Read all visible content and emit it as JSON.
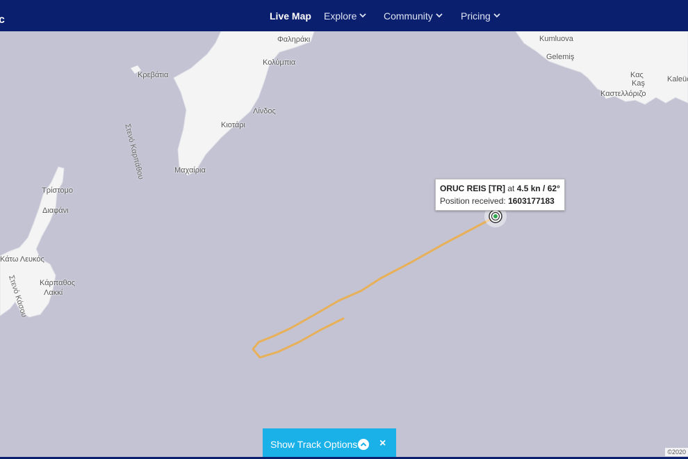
{
  "brand": {
    "text": "c"
  },
  "nav": [
    {
      "label": "Live Map",
      "active": true
    },
    {
      "label": "Explore",
      "dropdown": true
    },
    {
      "label": "Community",
      "dropdown": true
    },
    {
      "label": "Pricing",
      "dropdown": true
    }
  ],
  "map": {
    "places": {
      "falirakí": "Φαληράκι",
      "kolymbia": "Κολύμπια",
      "kremasti": "Κρεβάτια",
      "lindos": "Λίνδος",
      "kiotari": "Κιοτάρι",
      "machairia": "Μαχαίρια",
      "tristomo": "Τρίστομο",
      "diafani": "Διαφάνι",
      "kato_lefkos": "Κάτω Λευκός",
      "karpathos": "Κάρπαθος",
      "lakki": "Λακκί",
      "kumluova": "Kumluova",
      "gelemis": "Gelemiş",
      "kas_gr": "Κας",
      "kas": "Kaş",
      "kastellorizo": "Καστελλόριζο",
      "kaleucagiz": "Kaleüc"
    },
    "straits": {
      "karpathos_strait": "Στενό Καρπάθου",
      "kasos_strait": "Στενό Κάσου"
    },
    "colors": {
      "sea": "#c3c3d3",
      "land": "#f4f4f4",
      "track": "#e8b058",
      "navbar": "#0a1f6e"
    }
  },
  "vessel": {
    "name": "ORUC REIS [TR]",
    "at_text": "at",
    "speed_course": "4.5 kn / 62°",
    "position_label": "Position received:",
    "position_value": "1603177183",
    "icon": "vessel-target-icon"
  },
  "track_options": {
    "label": "Show Track Options",
    "close_symbol": "×"
  },
  "attribution": {
    "text": "©2020"
  }
}
